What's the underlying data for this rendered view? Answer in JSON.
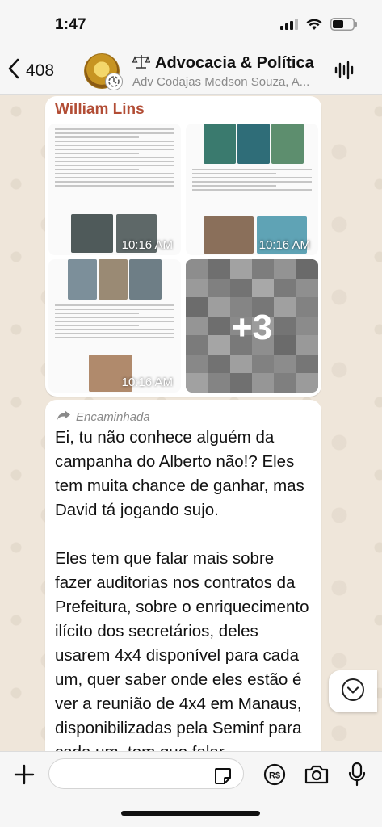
{
  "status_bar": {
    "time": "1:47"
  },
  "header": {
    "back_count": "408",
    "title": "Advocacia & Política",
    "subtitle": "Adv Codajas Medson Souza, A..."
  },
  "media_message": {
    "sender": "William Lins",
    "images": [
      {
        "time": "10:16 AM"
      },
      {
        "time": "10:16 AM"
      },
      {
        "time": "10:16 AM"
      }
    ],
    "more_count": "+3"
  },
  "text_message": {
    "forwarded_label": "Encaminhada",
    "body": "Ei, tu não conhece alguém da campanha do Alberto não!? Eles tem muita chance de ganhar, mas David tá jogando sujo.\n\nEles tem que falar mais sobre fazer auditorias nos contratos da Prefeitura, sobre o enriquecimento ilícito dos secretários, deles usarem 4x4 disponível para cada um, quer saber onde eles estão é ver a reunião de 4x4 em Manaus, disponibilizadas pela Seminf para cada um, tem que falar"
  },
  "input_bar": {
    "placeholder": ""
  },
  "colors": {
    "sender_name": "#b24d35",
    "bubble": "#ffffff",
    "wallpaper": "#efe6da"
  },
  "icons": [
    "chevron-left-icon",
    "voice-wave-icon",
    "forward-arrow-icon",
    "chevron-down-icon",
    "plus-icon",
    "sticker-icon",
    "payment-icon",
    "camera-icon",
    "microphone-icon"
  ]
}
